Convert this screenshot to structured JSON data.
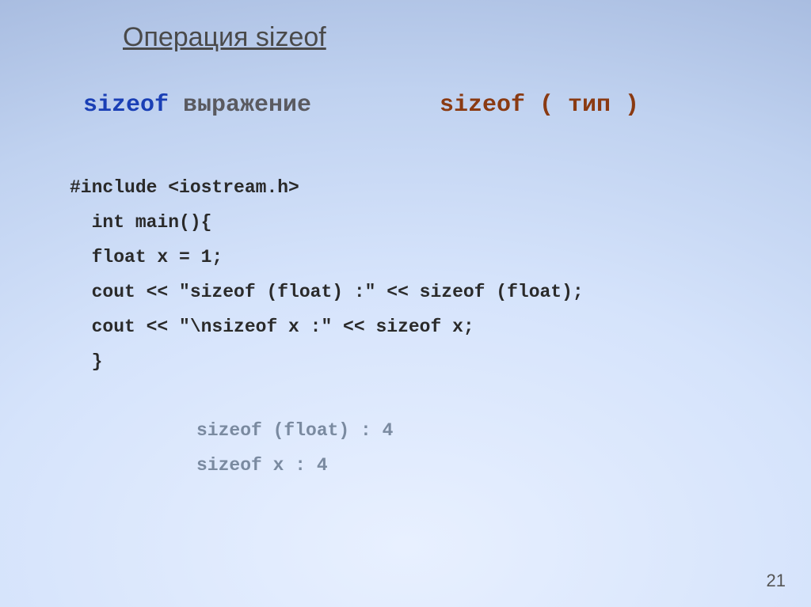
{
  "title": "Операция sizeof",
  "syntax": {
    "kw1": "sizeof",
    "part1": "  выражение",
    "kw2": "sizeof",
    "part2": " ( тип )"
  },
  "code": {
    "l1": "#include <iostream.h>",
    "l2": "  int main(){",
    "l3": "  float x = 1;",
    "l4": "  cout << \"sizeof (float) :\" << sizeof (float);",
    "l5": "  cout << \"\\nsizeof x :\" << sizeof x;",
    "l6": "  }"
  },
  "output": {
    "l1": "sizeof (float) : 4",
    "l2": "sizeof x : 4"
  },
  "page": "21"
}
